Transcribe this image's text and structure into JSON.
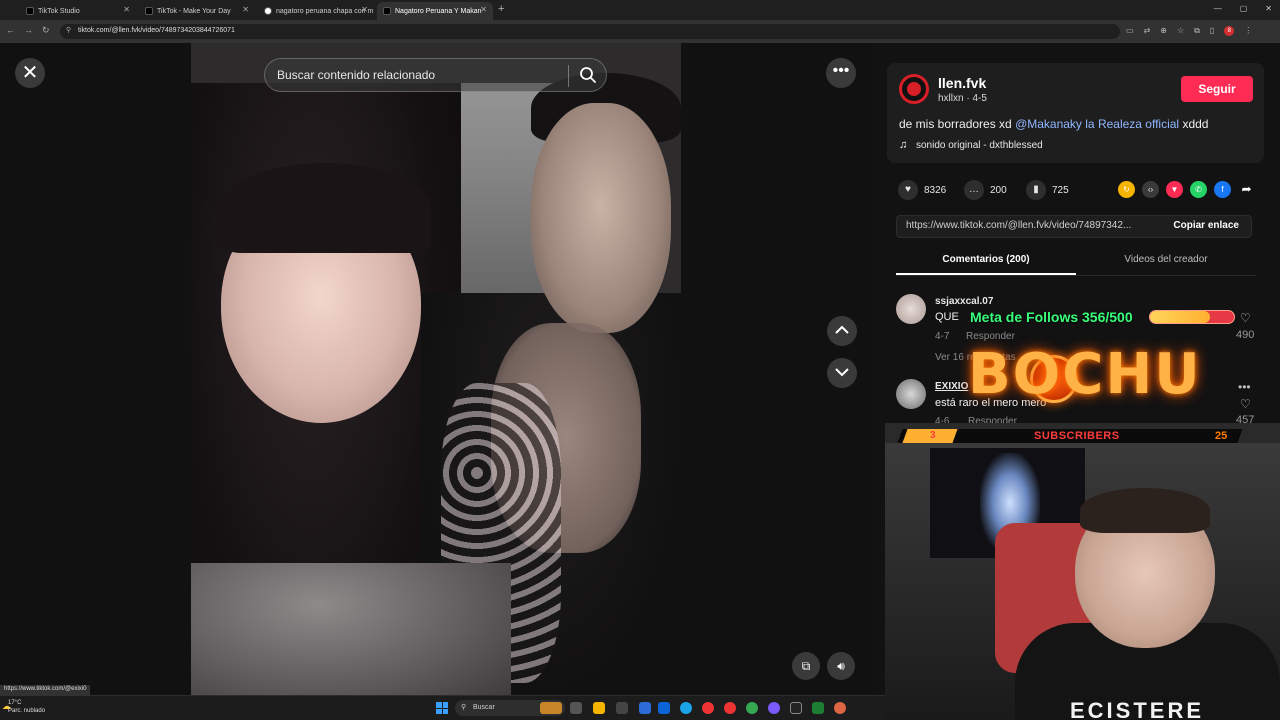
{
  "browser": {
    "tabs": [
      {
        "title": "TikTok Studio",
        "active": false
      },
      {
        "title": "TikTok - Make Your Day",
        "active": false
      },
      {
        "title": "nagatoro peruana chapa con m",
        "active": false
      },
      {
        "title": "Nagatoro Peruana Y Makan",
        "active": true
      }
    ],
    "new_tab": "+",
    "url": "tiktok.com/@llen.fvk/video/7489734203844726071",
    "status_url": "https://www.tiktok.com/@exixi0"
  },
  "video": {
    "search_placeholder": "Buscar contenido relacionado",
    "close_glyph": "✕",
    "more_glyph": "•••"
  },
  "post": {
    "username": "llen.fvk",
    "subline": "hxllxn · 4-5",
    "follow_label": "Seguir",
    "caption_before": "de mis borradores xd ",
    "caption_mention": "@Makanaky la Realeza official",
    "caption_after": " xddd",
    "music": "sonido original - dxthblessed",
    "likes": "8326",
    "comments": "200",
    "saves": "725",
    "link": "https://www.tiktok.com/@llen.fvk/video/74897342...",
    "copy_label": "Copiar enlace",
    "tab_comments": "Comentarios (200)",
    "tab_creator": "Videos del creador"
  },
  "comments": [
    {
      "user": "ssjaxxcal.07",
      "text": "QUE",
      "date": "4-7",
      "reply": "Responder",
      "likes": "490",
      "replies": "Ver 16 respuestas"
    },
    {
      "user": "EXIXIO",
      "text": "está raro el mero mero",
      "date": "4-6",
      "reply": "Responder",
      "likes": "457"
    }
  ],
  "overlay": {
    "goal_text": "Meta de Follows 356/500",
    "goal_progress": 0.712,
    "logo": "BOCHU",
    "sub_left": "3",
    "sub_label": "SUBSCRIBERS",
    "sub_right": "25",
    "shirt_text": "ECISTERE"
  },
  "taskbar": {
    "weather_temp": "17°C",
    "weather_desc": "Parc. nublado",
    "search": "Buscar"
  },
  "colors": {
    "follow": "#fe2c55",
    "mention": "#8fb7ff",
    "goal_text": "#39ff7a",
    "logo": "#ffb347"
  }
}
